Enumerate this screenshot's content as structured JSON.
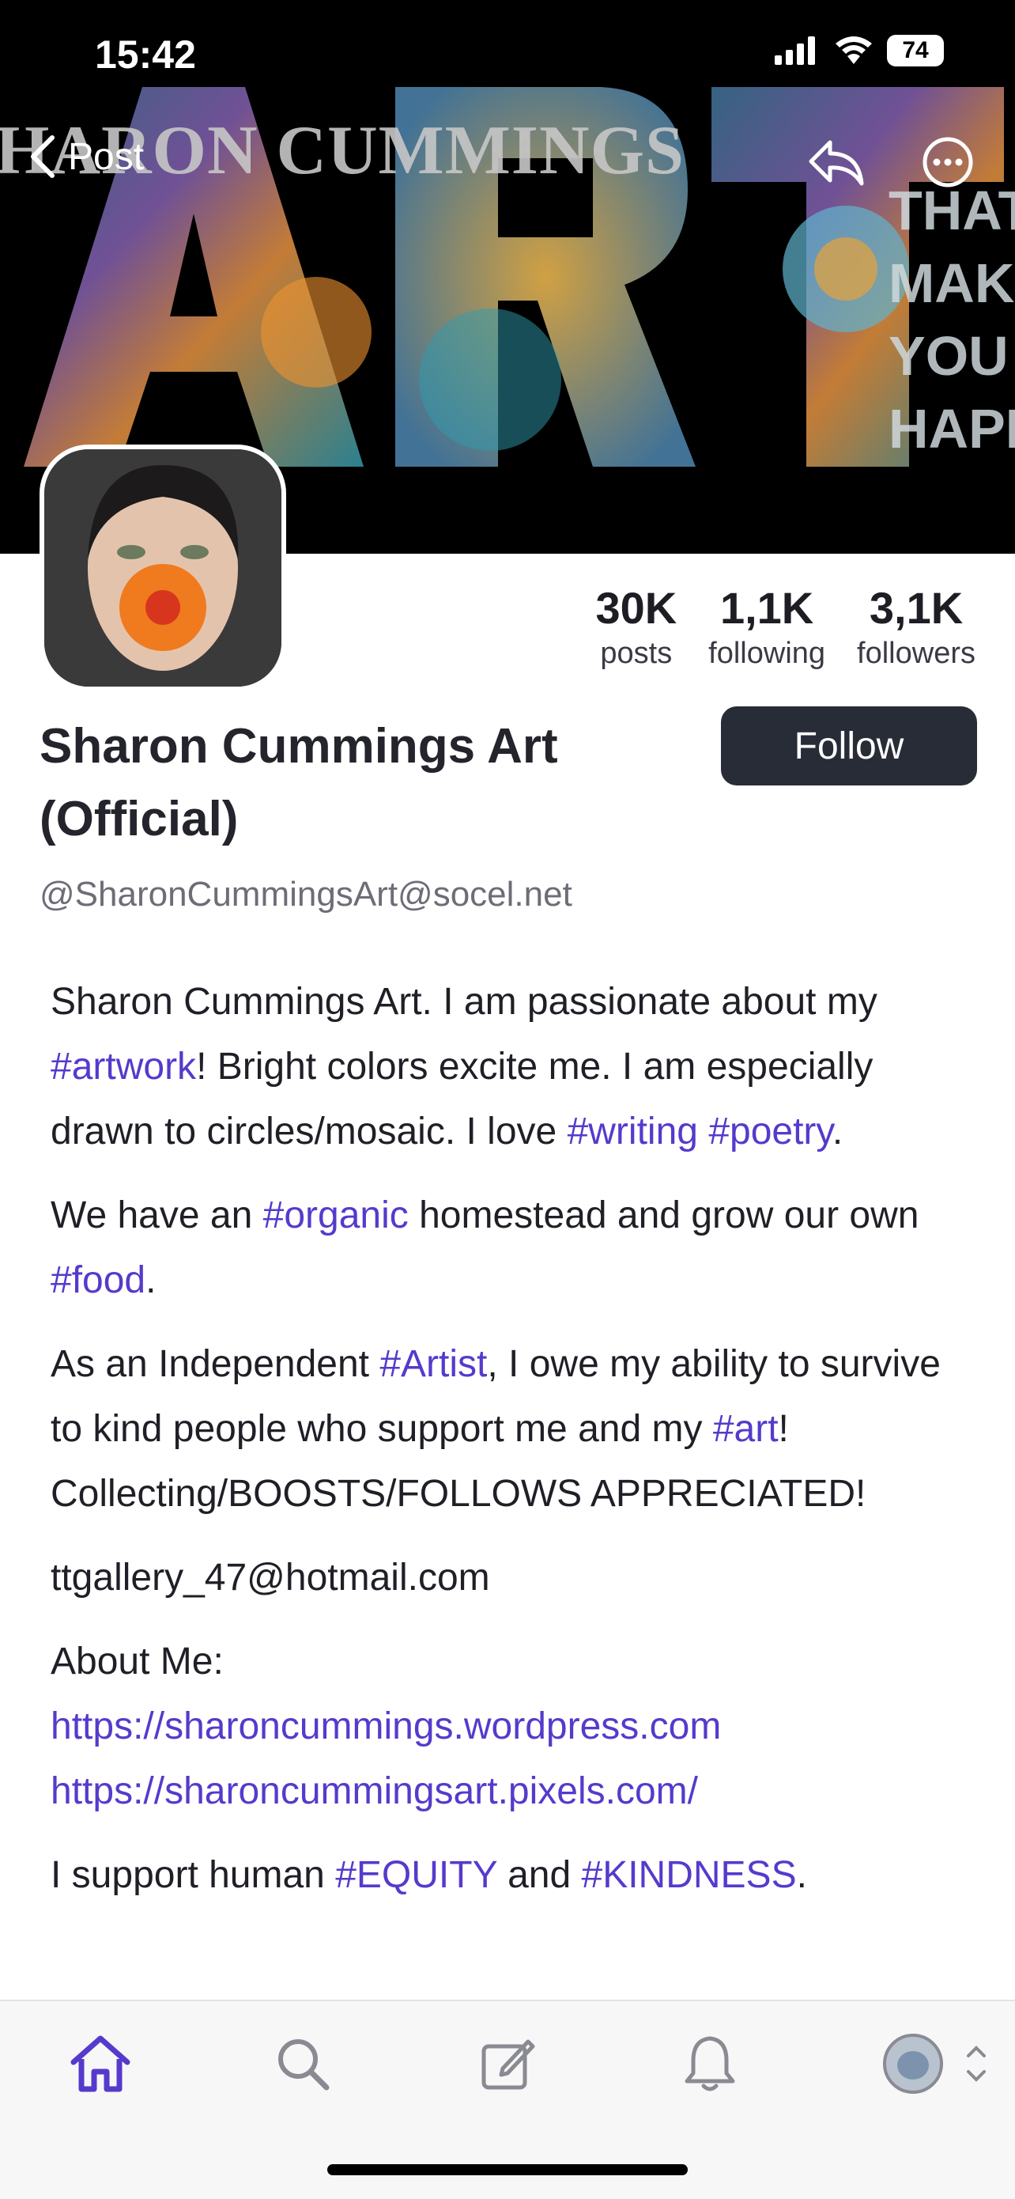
{
  "status_bar": {
    "time": "15:42",
    "battery": "74"
  },
  "nav": {
    "back_label": "Post"
  },
  "banner": {
    "heading": "HARON CUMMINGS",
    "tagline": "THAT\nMAK\nYOU\nHAPP"
  },
  "profile": {
    "display_name": "Sharon Cummings Art (Official)",
    "handle": "@SharonCummingsArt@socel.net",
    "follow_label": "Follow",
    "stats": [
      {
        "value": "30K",
        "label": "posts"
      },
      {
        "value": "1,1K",
        "label": "following"
      },
      {
        "value": "3,1K",
        "label": "followers"
      }
    ]
  },
  "bio": {
    "p1_a": "Sharon Cummings Art.  I am passionate about my ",
    "p1_tag1": "#artwork",
    "p1_b": "!  Bright colors excite me.  I am especially drawn to circles/mosaic.  I love ",
    "p1_tag2": "#writing",
    "p1_tag3": "#poetry",
    "p1_c": ".",
    "p2_a": "We have an ",
    "p2_tag1": "#organic",
    "p2_b": " homestead and grow our own ",
    "p2_tag2": "#food",
    "p2_c": ".",
    "p3_a": "As an Independent ",
    "p3_tag1": "#Artist",
    "p3_b": ", I owe my ability to survive to kind people who support me and my ",
    "p3_tag2": "#art",
    "p3_c": "!  Collecting/BOOSTS/FOLLOWS APPRECIATED!",
    "p4": "ttgallery_47@hotmail.com",
    "p5_label": "About Me:",
    "p5_link1": "https://sharoncummings.wordpress.com",
    "p5_link2": "https://sharoncummingsart.pixels.com/",
    "p6_a": "I support human ",
    "p6_tag1": "#EQUITY",
    "p6_b": " and ",
    "p6_tag2": "#KINDNESS",
    "p6_c": "."
  },
  "colors": {
    "accent": "#563acc",
    "follow_bg": "#282c37"
  },
  "tab_bar": [
    "home-icon",
    "search-icon",
    "compose-icon",
    "bell-icon",
    "account-switcher"
  ]
}
